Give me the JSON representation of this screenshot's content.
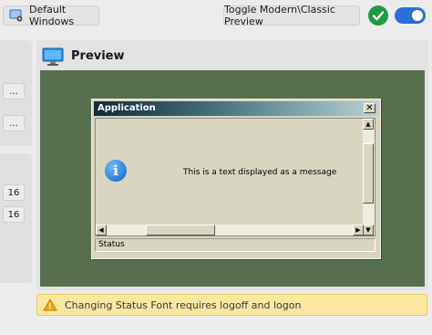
{
  "toolbar": {
    "default_windows_label": "Default Windows",
    "toggle_preview_label": "Toggle Modern\\Classic Preview",
    "check_icon": "check-circle-icon",
    "switch_state": "on"
  },
  "side_panel_1": {
    "buttons": [
      "...",
      "..."
    ]
  },
  "side_panel_2": {
    "values": [
      "16",
      "16"
    ]
  },
  "preview": {
    "title": "Preview",
    "window": {
      "title": "Application",
      "close_glyph": "✕",
      "message": "This is a text displayed as a message",
      "status": "Status"
    }
  },
  "warning": {
    "text": "Changing Status Font requires logoff and logon"
  },
  "colors": {
    "desktop": "#586f4f",
    "classic_face": "#d8d5c1",
    "warning_bg": "#fbe6a2",
    "accent_blue": "#2a6fd6",
    "check_green": "#1f9a47"
  }
}
